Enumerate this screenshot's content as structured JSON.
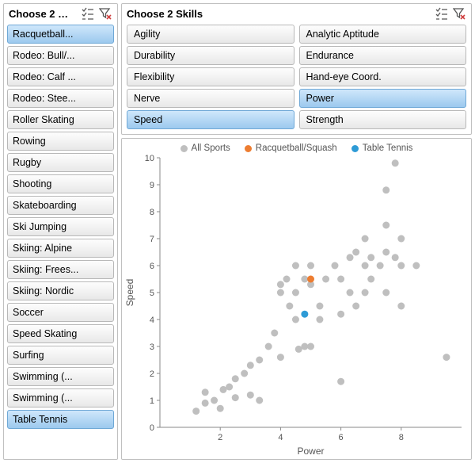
{
  "left_panel": {
    "title": "Choose 2 …",
    "items": [
      {
        "label": "Racquetball...",
        "selected": true
      },
      {
        "label": "Rodeo: Bull/...",
        "selected": false
      },
      {
        "label": "Rodeo: Calf ...",
        "selected": false
      },
      {
        "label": "Rodeo: Stee...",
        "selected": false
      },
      {
        "label": "Roller Skating",
        "selected": false
      },
      {
        "label": "Rowing",
        "selected": false
      },
      {
        "label": "Rugby",
        "selected": false
      },
      {
        "label": "Shooting",
        "selected": false
      },
      {
        "label": "Skateboarding",
        "selected": false
      },
      {
        "label": "Ski Jumping",
        "selected": false
      },
      {
        "label": "Skiing: Alpine",
        "selected": false
      },
      {
        "label": "Skiing: Frees...",
        "selected": false
      },
      {
        "label": "Skiing: Nordic",
        "selected": false
      },
      {
        "label": "Soccer",
        "selected": false
      },
      {
        "label": "Speed Skating",
        "selected": false
      },
      {
        "label": "Surfing",
        "selected": false
      },
      {
        "label": "Swimming (...",
        "selected": false
      },
      {
        "label": "Swimming (...",
        "selected": false
      },
      {
        "label": "Table Tennis",
        "selected": true
      }
    ]
  },
  "skills_panel": {
    "title": "Choose 2 Skills",
    "items": [
      {
        "label": "Agility",
        "selected": false
      },
      {
        "label": "Analytic Aptitude",
        "selected": false
      },
      {
        "label": "Durability",
        "selected": false
      },
      {
        "label": "Endurance",
        "selected": false
      },
      {
        "label": "Flexibility",
        "selected": false
      },
      {
        "label": "Hand-eye Coord.",
        "selected": false
      },
      {
        "label": "Nerve",
        "selected": false
      },
      {
        "label": "Power",
        "selected": true
      },
      {
        "label": "Speed",
        "selected": true
      },
      {
        "label": "Strength",
        "selected": false
      }
    ]
  },
  "chart_data": {
    "type": "scatter",
    "title": "",
    "xlabel": "Power",
    "ylabel": "Speed",
    "xlim": [
      0,
      10
    ],
    "ylim": [
      0,
      10
    ],
    "xticks": [
      2,
      4,
      6,
      8
    ],
    "yticks": [
      0,
      1,
      2,
      3,
      4,
      5,
      6,
      7,
      8,
      9,
      10
    ],
    "legend": [
      {
        "name": "All Sports",
        "color": "#bfbfbf"
      },
      {
        "name": "Racquetball/Squash",
        "color": "#ed7d31"
      },
      {
        "name": "Table Tennis",
        "color": "#2e9bd6"
      }
    ],
    "series": [
      {
        "name": "All Sports",
        "color": "#bfbfbf",
        "points": [
          [
            1.2,
            0.6
          ],
          [
            1.5,
            0.9
          ],
          [
            1.5,
            1.3
          ],
          [
            1.8,
            1.0
          ],
          [
            2.0,
            0.7
          ],
          [
            2.1,
            1.4
          ],
          [
            2.3,
            1.5
          ],
          [
            2.5,
            1.1
          ],
          [
            2.5,
            1.8
          ],
          [
            2.8,
            2.0
          ],
          [
            3.0,
            1.2
          ],
          [
            3.0,
            2.3
          ],
          [
            3.3,
            1.0
          ],
          [
            3.3,
            2.5
          ],
          [
            3.6,
            3.0
          ],
          [
            3.8,
            3.5
          ],
          [
            4.0,
            2.6
          ],
          [
            4.0,
            5.0
          ],
          [
            4.0,
            5.3
          ],
          [
            4.2,
            5.5
          ],
          [
            4.3,
            4.5
          ],
          [
            4.5,
            4.0
          ],
          [
            4.5,
            5.0
          ],
          [
            4.5,
            6.0
          ],
          [
            4.6,
            2.9
          ],
          [
            4.8,
            3.0
          ],
          [
            4.8,
            5.5
          ],
          [
            5.0,
            3.0
          ],
          [
            5.0,
            5.3
          ],
          [
            5.0,
            6.0
          ],
          [
            5.3,
            4.0
          ],
          [
            5.3,
            4.5
          ],
          [
            5.5,
            5.5
          ],
          [
            5.8,
            6.0
          ],
          [
            6.0,
            1.7
          ],
          [
            6.0,
            4.2
          ],
          [
            6.0,
            5.5
          ],
          [
            6.3,
            5.0
          ],
          [
            6.3,
            6.3
          ],
          [
            6.5,
            4.5
          ],
          [
            6.5,
            6.5
          ],
          [
            6.8,
            5.0
          ],
          [
            6.8,
            6.0
          ],
          [
            6.8,
            7.0
          ],
          [
            7.0,
            5.5
          ],
          [
            7.0,
            6.3
          ],
          [
            7.3,
            6.0
          ],
          [
            7.5,
            5.0
          ],
          [
            7.5,
            6.5
          ],
          [
            7.5,
            7.5
          ],
          [
            7.5,
            8.8
          ],
          [
            7.8,
            6.3
          ],
          [
            7.8,
            9.8
          ],
          [
            8.0,
            4.5
          ],
          [
            8.0,
            6.0
          ],
          [
            8.0,
            7.0
          ],
          [
            8.5,
            6.0
          ],
          [
            9.5,
            2.6
          ]
        ]
      },
      {
        "name": "Racquetball/Squash",
        "color": "#ed7d31",
        "points": [
          [
            5.0,
            5.5
          ]
        ]
      },
      {
        "name": "Table Tennis",
        "color": "#2e9bd6",
        "points": [
          [
            4.8,
            4.2
          ]
        ]
      }
    ]
  }
}
